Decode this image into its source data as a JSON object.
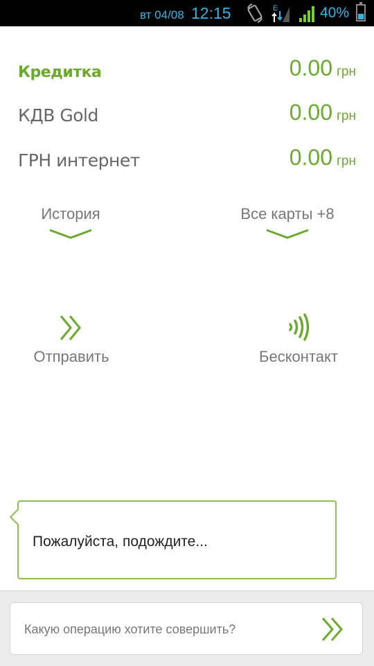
{
  "status_bar": {
    "date": "вт 04/08",
    "time": "12:15",
    "network_label": "E",
    "battery": "40%",
    "battery_level": 0.4,
    "accent_color": "#33b5e5"
  },
  "accounts": [
    {
      "name": "Кредитка",
      "amount": "0.00",
      "currency": "грн",
      "active": true
    },
    {
      "name": "КДВ Gold",
      "amount": "0.00",
      "currency": "грн",
      "active": false
    },
    {
      "name": "ГРН интернет",
      "amount": "0.00",
      "currency": "грн",
      "active": false
    }
  ],
  "toggles": {
    "history": "История",
    "all_cards": "Все карты +8"
  },
  "actions": {
    "send": {
      "label": "Отправить",
      "icon": "double-chevron-right-icon"
    },
    "contactless": {
      "label": "Бесконтакт",
      "icon": "nfc-waves-icon"
    }
  },
  "wait_message": "Пожалуйста, подождите...",
  "input": {
    "placeholder": "Какую операцию хотите совершить?",
    "send_icon": "double-chevron-right-icon"
  },
  "colors": {
    "brand_green": "#6aaa2c",
    "border_green": "#8dc04f"
  }
}
